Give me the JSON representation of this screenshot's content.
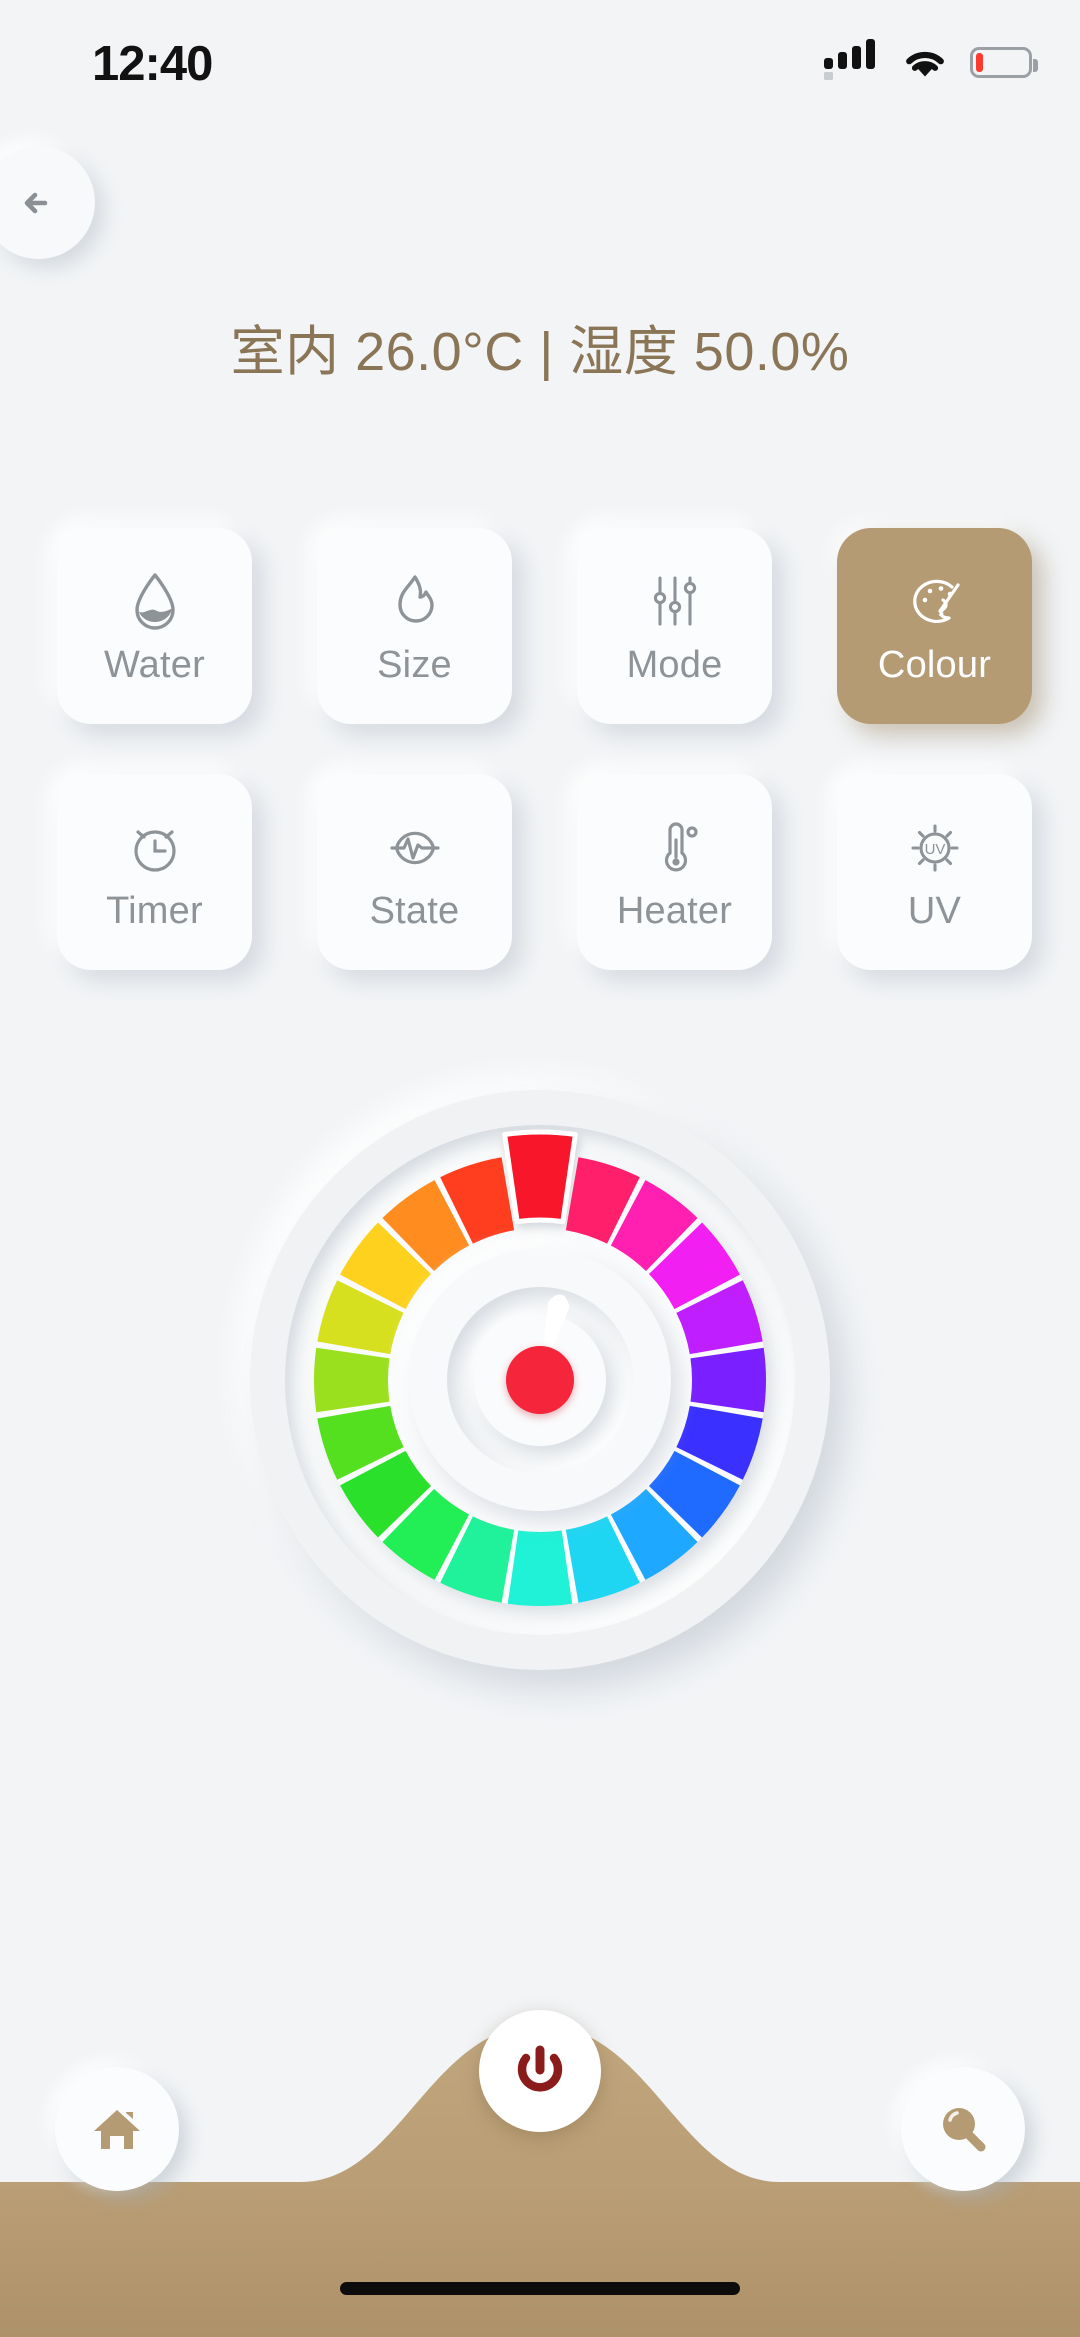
{
  "status_bar": {
    "time": "12:40",
    "signal_icon": "cellular-signal-icon",
    "wifi_icon": "wifi-icon",
    "battery_icon": "battery-low-icon",
    "battery_level_percent": 10,
    "battery_color": "#fb3b30"
  },
  "nav": {
    "back_icon": "arrow-left-icon"
  },
  "header": {
    "title": "室内 26.0°C | 湿度 50.0%",
    "indoor_label": "室内",
    "temperature": "26.0°C",
    "separator": "|",
    "humidity_label": "湿度",
    "humidity": "50.0%",
    "title_color": "#8a7656"
  },
  "controls": {
    "active_color": "#b49b74",
    "inactive_label_color": "#8e9398",
    "tiles": [
      {
        "id": "water",
        "label": "Water",
        "icon": "water-drop-icon",
        "active": false
      },
      {
        "id": "size",
        "label": "Size",
        "icon": "flame-icon",
        "active": false
      },
      {
        "id": "mode",
        "label": "Mode",
        "icon": "sliders-icon",
        "active": false
      },
      {
        "id": "colour",
        "label": "Colour",
        "icon": "palette-icon",
        "active": true
      },
      {
        "id": "timer",
        "label": "Timer",
        "icon": "alarm-clock-icon",
        "active": false
      },
      {
        "id": "state",
        "label": "State",
        "icon": "pulse-circle-icon",
        "active": false
      },
      {
        "id": "heater",
        "label": "Heater",
        "icon": "thermometer-icon",
        "active": false
      },
      {
        "id": "uv",
        "label": "UV",
        "icon": "uv-sun-icon",
        "active": false
      }
    ]
  },
  "colour_wheel": {
    "name": "colour-picker-dial",
    "segment_count": 20,
    "selected_index": 0,
    "selected_color": "#f7142a",
    "center_dot_color": "#f5253c",
    "needle_icon": "dial-needle-icon",
    "needle_angle_deg": 14,
    "segments": [
      "#f7142a",
      "#ff1f6b",
      "#ff1fb0",
      "#f21ff2",
      "#bf1fff",
      "#7a1fff",
      "#3a30ff",
      "#1f6bff",
      "#1fa8ff",
      "#1fd6f2",
      "#1ff2d6",
      "#1ff29a",
      "#22ee55",
      "#2ae02a",
      "#55e01f",
      "#9ae01f",
      "#d6e01f",
      "#ffd11f",
      "#ff8c1f",
      "#ff3d1f"
    ]
  },
  "bottom_bar": {
    "bar_color": "#b99d74",
    "home_icon": "home-icon",
    "search_icon": "search-icon",
    "power_icon": "power-icon",
    "power_icon_color": "#8a1c1c",
    "home_indicator": "home-indicator-bar"
  }
}
